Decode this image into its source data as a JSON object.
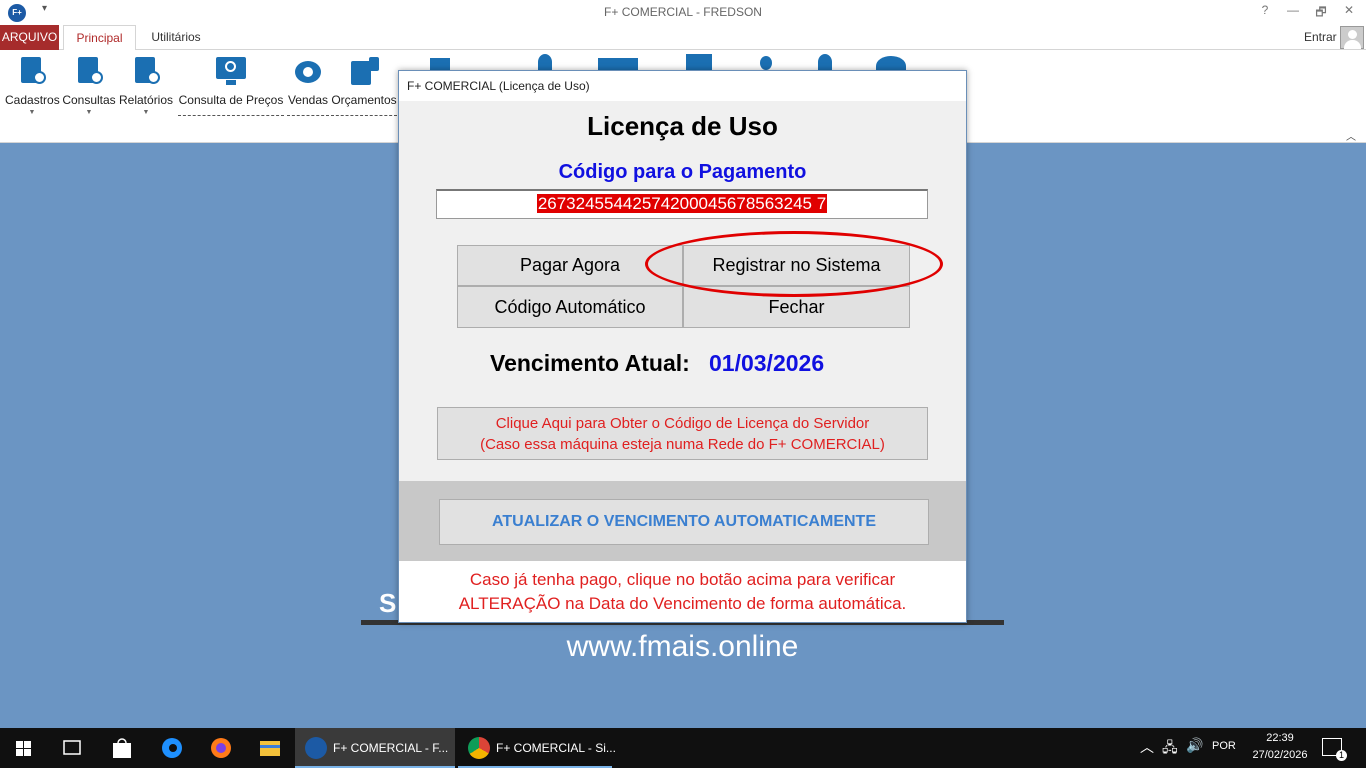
{
  "window": {
    "title": "F+ COMERCIAL - FREDSON",
    "app_logo": "F+",
    "help": "?",
    "minimize": "—",
    "restore": "🗗",
    "close": "✕"
  },
  "ribbon_tabs": {
    "arquivo": "ARQUIVO",
    "principal": "Principal",
    "utilitarios": "Utilitários",
    "entrar": "Entrar"
  },
  "ribbon": {
    "cadastros": "Cadastros",
    "consultas": "Consultas",
    "relatorios": "Relatórios",
    "consulta_precos": "Consulta de Preços",
    "vendas": "Vendas",
    "orcamentos": "Orçamentos"
  },
  "background": {
    "slogan": "S                                                                                    L",
    "url": "www.fmais.online"
  },
  "dialog": {
    "title": "F+ COMERCIAL (Licença de Uso)",
    "heading": "Licença de Uso",
    "code_caption": "Código para o Pagamento",
    "code_value": "26732455442574200045678563245 7",
    "pagar": "Pagar Agora",
    "registrar": "Registrar no Sistema",
    "codigo_auto": "Código Automático",
    "fechar": "Fechar",
    "vencimento_label": "Vencimento Atual:",
    "vencimento_date": "01/03/2026",
    "servidor_line1": "Clique Aqui para Obter o Código de Licença do Servidor",
    "servidor_line2": "(Caso essa máquina esteja numa Rede do F+ COMERCIAL)",
    "atualizar": "ATUALIZAR O VENCIMENTO AUTOMATICAMENTE",
    "footer_line1": "Caso já tenha pago, clique no botão acima para verificar",
    "footer_line2": "ALTERAÇÃO na Data do Vencimento de forma automática."
  },
  "taskbar": {
    "task1": "F+ COMERCIAL - F...",
    "task2": "F+ COMERCIAL - Si...",
    "lang": "POR",
    "time": "22:39",
    "date": "27/02/2026",
    "notif_count": "1"
  },
  "colors": {
    "accent_red": "#a62c2c",
    "desktop_blue": "#6b95c3",
    "code_blue": "#1010e0",
    "alert_red": "#e02020"
  }
}
